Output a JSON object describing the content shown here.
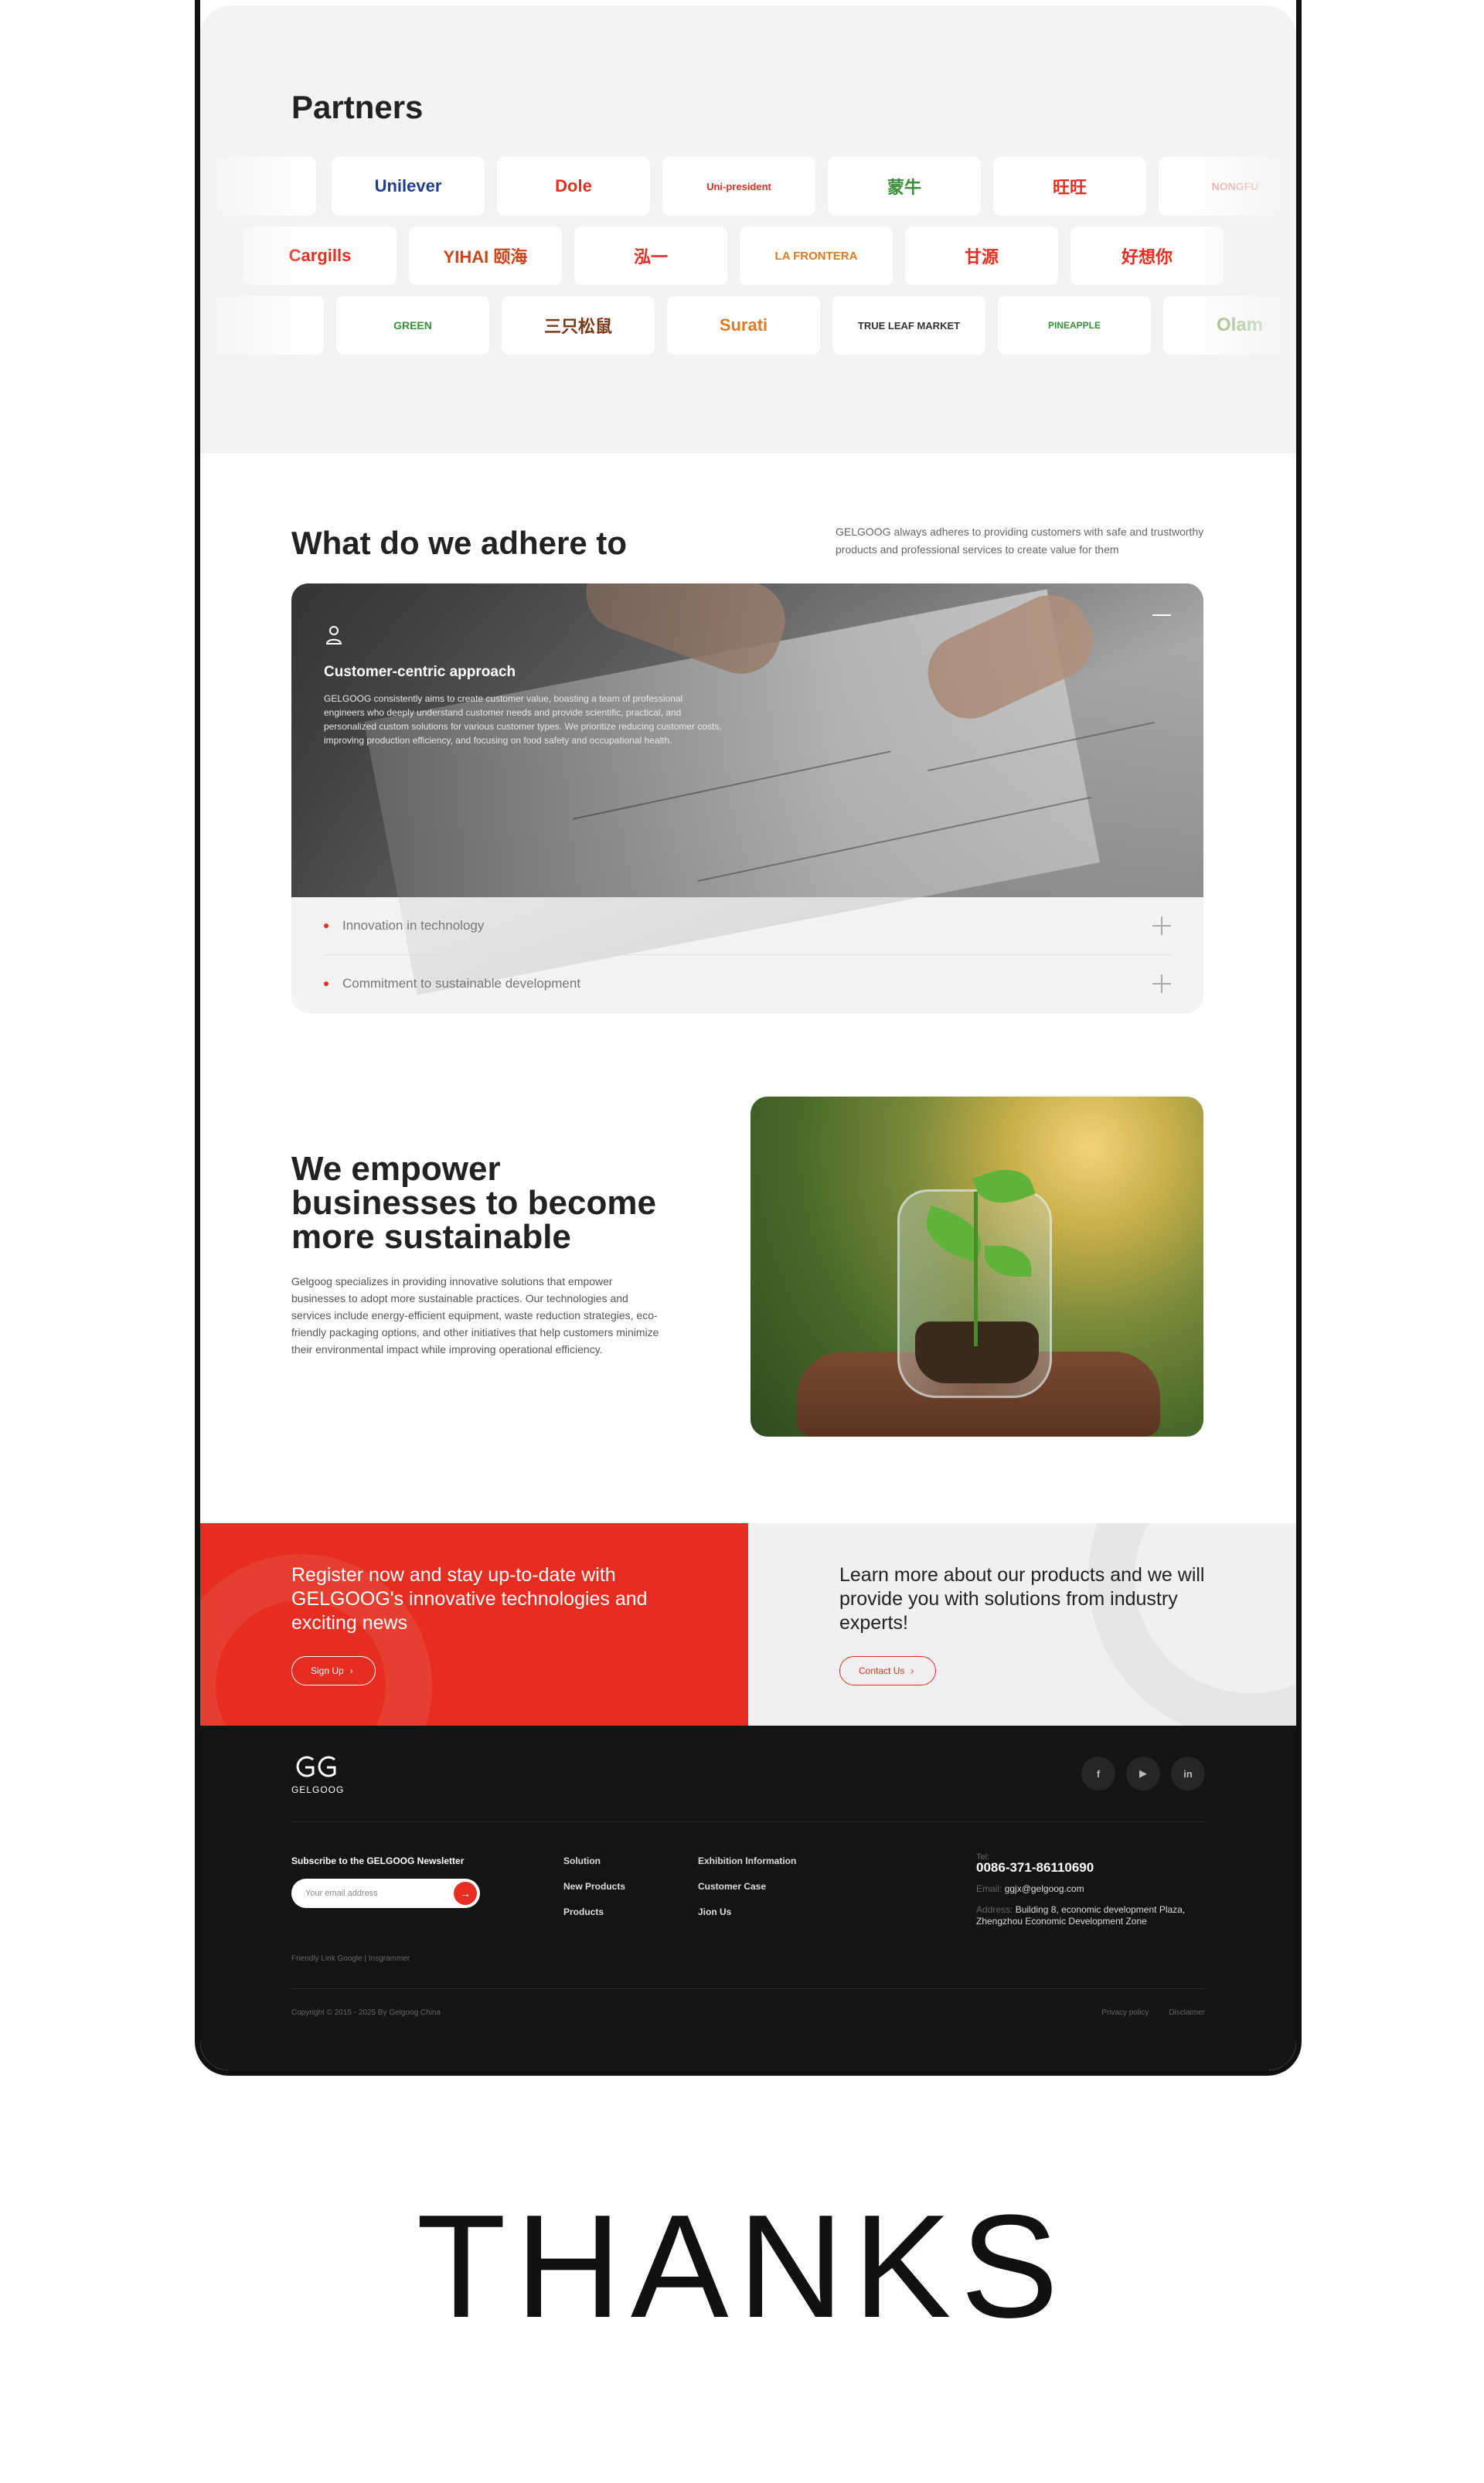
{
  "partners": {
    "title": "Partners",
    "rows": [
      [
        "",
        "Unilever",
        "Dole",
        "Uni-president",
        "蒙牛",
        "旺旺",
        "NONGFU"
      ],
      [
        "Cargills",
        "YIHAI 颐海",
        "泓一",
        "LA FRONTERA",
        "甘源",
        "好想你"
      ],
      [
        "",
        "GREEN",
        "三只松鼠",
        "Surati",
        "TRUE LEAF MARKET",
        "PINEAPPLE",
        "Olam"
      ]
    ],
    "colors": {
      "red": "#e52e21",
      "blue": "#1f3d8a",
      "green": "#3a8f3a",
      "orange": "#e07a20"
    }
  },
  "adhere": {
    "title": "What do we adhere to",
    "description": "GELGOOG always adheres to providing customers with safe and trustworthy products and professional services to create value for them",
    "active": {
      "icon": "person-pin-icon",
      "title": "Customer-centric approach",
      "text": "GELGOOG consistently aims to create customer value, boasting a team of professional engineers who deeply understand customer needs and provide scientific, practical, and personalized custom solutions for various customer types. We prioritize reducing customer costs, improving production efficiency, and focusing on food safety and occupational health."
    },
    "items": [
      "Innovation in technology",
      "Commitment to sustainable development"
    ]
  },
  "sustainable": {
    "title": "We empower businesses to become more sustainable",
    "text": "Gelgoog specializes in providing innovative solutions that empower businesses to adopt more sustainable practices. Our technologies and services include energy-efficient equipment, waste reduction strategies, eco-friendly packaging options, and other initiatives that help customers minimize their environmental impact while improving operational efficiency."
  },
  "cta": {
    "left_title": "Register now and stay up-to-date with GELGOOG's innovative technologies and exciting news",
    "left_button": "Sign Up",
    "right_title": "Learn more about our products and we will provide you with solutions from industry experts!",
    "right_button": "Contact Us",
    "accent": "#e52e21"
  },
  "footer": {
    "brand": "GELGOOG",
    "socials": [
      "f",
      "▶",
      "in"
    ],
    "newsletter_title": "Subscribe to the GELGOOG Newsletter",
    "email_placeholder": "Your email address",
    "col1": [
      "Solution",
      "New Products",
      "Products"
    ],
    "col2": [
      "Exhibition Information",
      "Customer Case",
      "Jion Us"
    ],
    "tel_label": "Tel:",
    "tel": "0086-371-86110690",
    "email_label": "Email:",
    "email": "ggjx@gelgoog.com",
    "address_label": "Address:",
    "address": "Building 8, economic development Plaza, Zhengzhou Economic Development Zone",
    "friendly": "Friendly Link   Google  |  Insgrammer",
    "copyright": "Copyright © 2015 - 2025 By Gelgoog China",
    "privacy": "Privacy policy",
    "disclaimer": "Disclaimer"
  },
  "thanks": "THANKS"
}
